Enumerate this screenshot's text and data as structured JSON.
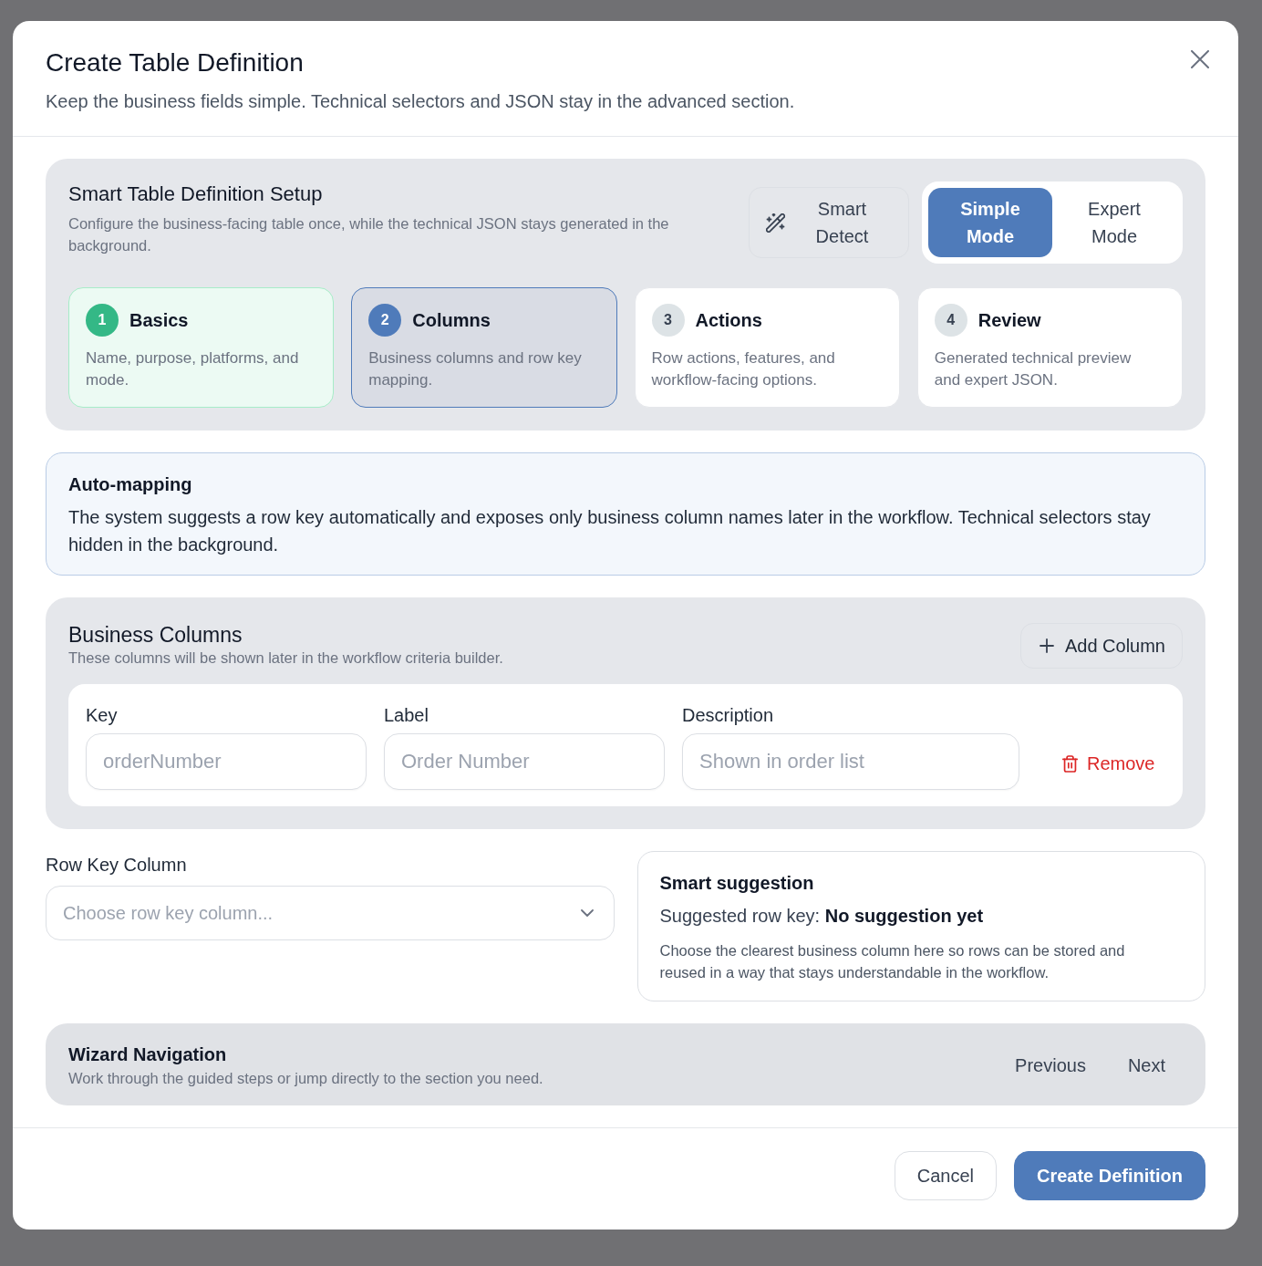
{
  "dialog": {
    "title": "Create Table Definition",
    "subtitle": "Keep the business fields simple. Technical selectors and JSON stay in the advanced section."
  },
  "setup": {
    "title": "Smart Table Definition Setup",
    "description": "Configure the business-facing table once, while the technical JSON stays generated in the background.",
    "smart_detect": "Smart Detect",
    "modes": [
      {
        "label": "Simple Mode",
        "selected": true
      },
      {
        "label": "Expert Mode",
        "selected": false
      }
    ],
    "steps": [
      {
        "number": "1",
        "title": "Basics",
        "description": "Name, purpose, platforms, and mode.",
        "completed": true,
        "selected": false
      },
      {
        "number": "2",
        "title": "Columns",
        "description": "Business columns and row key mapping.",
        "completed": false,
        "selected": true
      },
      {
        "number": "3",
        "title": "Actions",
        "description": "Row actions, features, and workflow-facing options.",
        "completed": false,
        "selected": false
      },
      {
        "number": "4",
        "title": "Review",
        "description": "Generated technical preview and expert JSON.",
        "completed": false,
        "selected": false
      }
    ]
  },
  "auto_mapping": {
    "title": "Auto-mapping",
    "text": "The system suggests a row key automatically and exposes only business column names later in the workflow. Technical selectors stay hidden in the background."
  },
  "business_columns": {
    "title": "Business Columns",
    "description": "These columns will be shown later in the workflow criteria builder.",
    "add_button": "Add Column",
    "rows": [
      {
        "fields": [
          {
            "label": "Key",
            "placeholder": "orderNumber"
          },
          {
            "label": "Label",
            "placeholder": "Order Number"
          },
          {
            "label": "Description",
            "placeholder": "Shown in order list"
          }
        ],
        "remove_button": "Remove"
      }
    ]
  },
  "row_key": {
    "label": "Row Key Column",
    "placeholder": "Choose row key column..."
  },
  "suggestion": {
    "title": "Smart suggestion",
    "value": "Suggested row key: **No suggestion yet**",
    "note": "Choose the clearest business column here so rows can be stored and reused in a way that stays understandable in the workflow."
  },
  "wizard": {
    "title": "Wizard Navigation",
    "description": "Work through the guided steps or jump directly to the section you need.",
    "buttons": [
      "Previous",
      "Next"
    ]
  },
  "footer": {
    "buttons": [
      {
        "label": "Cancel",
        "kind": "secondary"
      },
      {
        "label": "Create Definition",
        "kind": "primary"
      }
    ]
  }
}
